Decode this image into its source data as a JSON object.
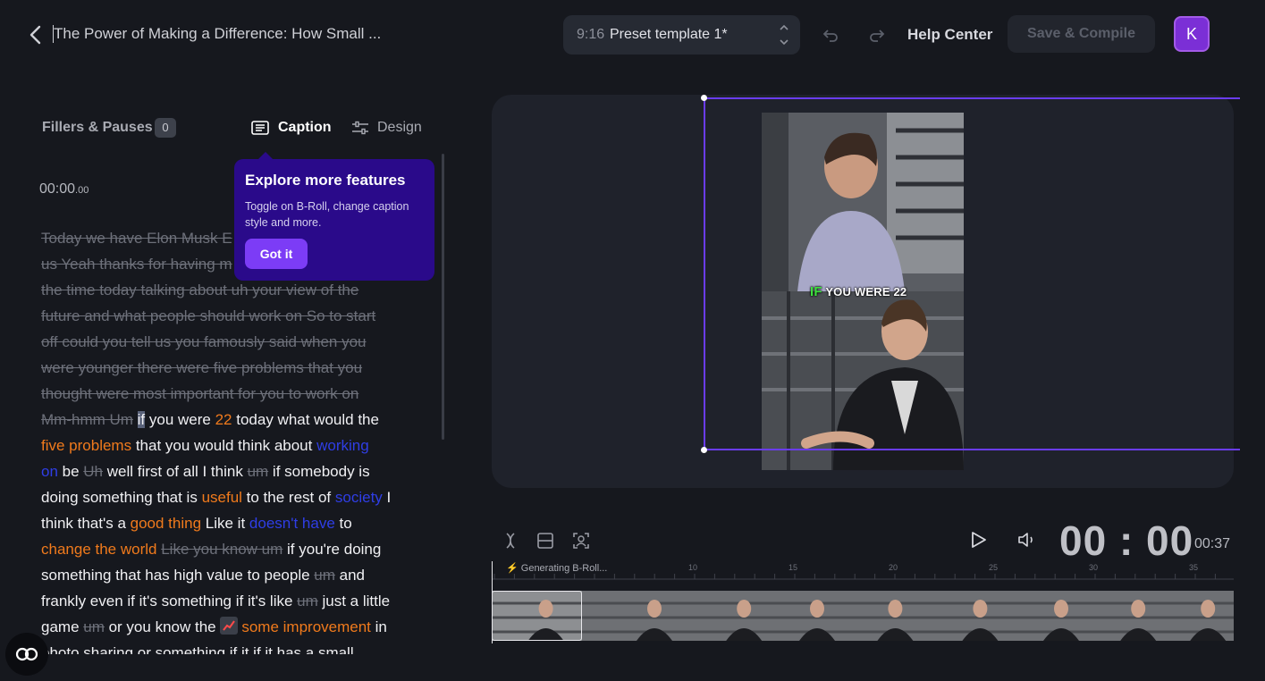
{
  "header": {
    "title": "The Power of Making a Difference: How Small ...",
    "preset_ratio": "9:16",
    "preset_name": "Preset template 1*",
    "help_label": "Help Center",
    "save_label": "Save & Compile",
    "avatar_initial": "K",
    "accent_color": "#7b2fd6"
  },
  "left_panel": {
    "fillers_label": "Fillers & Pauses",
    "fillers_count": "0",
    "tab_caption": "Caption",
    "tab_design": "Design",
    "time_main": "00:00",
    "time_ms": ".00",
    "transcript_lines": [
      [
        {
          "t": "Today we have Elon Musk E",
          "s": "s"
        }
      ],
      [
        {
          "t": "us Yeah thanks for having m",
          "s": "s"
        }
      ],
      [
        {
          "t": "the time today talking about uh your view of the",
          "s": "s"
        }
      ],
      [
        {
          "t": "future and what people should work on So to start",
          "s": "s"
        }
      ],
      [
        {
          "t": "off could you tell us you famously said when you",
          "s": "s"
        }
      ],
      [
        {
          "t": "were younger there were five problems that you",
          "s": "s"
        }
      ],
      [
        {
          "t": "thought were most important for you to work on",
          "s": "s"
        }
      ],
      [
        {
          "t": "Mm-hmm Um",
          "s": "s"
        },
        {
          "t": " "
        },
        {
          "t": "if",
          "s": "hl"
        },
        {
          "t": " you were "
        },
        {
          "t": "22",
          "s": "o"
        },
        {
          "t": " today what would the"
        }
      ],
      [
        {
          "t": "five problems",
          "s": "o"
        },
        {
          "t": " that you would think about "
        },
        {
          "t": "working",
          "s": "b"
        }
      ],
      [
        {
          "t": "on",
          "s": "b"
        },
        {
          "t": " be "
        },
        {
          "t": "Uh",
          "s": "s"
        },
        {
          "t": " well first of all I think "
        },
        {
          "t": "um",
          "s": "s"
        },
        {
          "t": " if somebody is"
        }
      ],
      [
        {
          "t": "doing something that is "
        },
        {
          "t": "useful",
          "s": "o"
        },
        {
          "t": " to the rest of "
        },
        {
          "t": "society",
          "s": "b"
        },
        {
          "t": " I"
        }
      ],
      [
        {
          "t": "think that's a "
        },
        {
          "t": "good thing",
          "s": "o"
        },
        {
          "t": " Like it "
        },
        {
          "t": "doesn't have",
          "s": "b"
        },
        {
          "t": " to"
        }
      ],
      [
        {
          "t": "change the world",
          "s": "o"
        },
        {
          "t": " "
        },
        {
          "t": "Like you know um",
          "s": "s"
        },
        {
          "t": " if you're doing"
        }
      ],
      [
        {
          "t": "something that has high value to people "
        },
        {
          "t": "um",
          "s": "s"
        },
        {
          "t": " and"
        }
      ],
      [
        {
          "t": "frankly even if it's something if it's like "
        },
        {
          "t": "um",
          "s": "s"
        },
        {
          "t": " just a little"
        }
      ],
      [
        {
          "t": "game "
        },
        {
          "t": "um",
          "s": "s"
        },
        {
          "t": " or you know the "
        },
        {
          "t": "",
          "s": "emo"
        },
        {
          "t": "some improvement",
          "s": "o"
        },
        {
          "t": " in"
        }
      ],
      [
        {
          "t": "photo sharing or something if it if it has a small"
        }
      ]
    ]
  },
  "tooltip": {
    "title": "Explore more features",
    "body": "Toggle on B-Roll, change caption style and more.",
    "button": "Got it"
  },
  "preview": {
    "caption_word_highlight": "IF",
    "caption_rest": "YOU WERE 22"
  },
  "controls": {
    "timecode": "00 : 00",
    "duration": "00:37",
    "generating_label": "Generating B-Roll...",
    "ruler_ticks": [
      "10",
      "15",
      "20",
      "25",
      "30",
      "35"
    ]
  }
}
